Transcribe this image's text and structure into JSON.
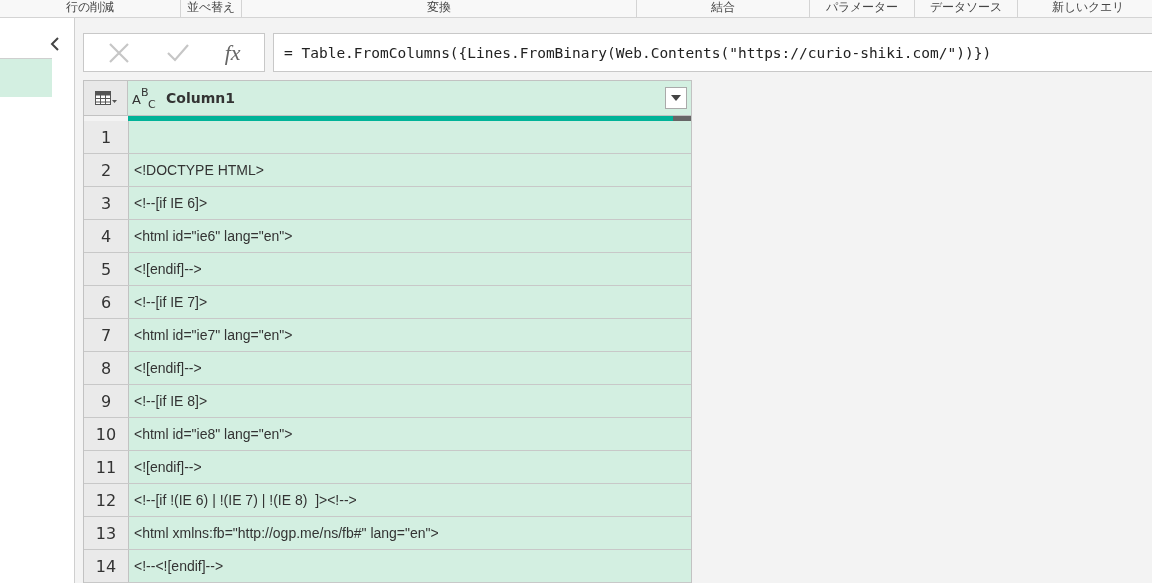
{
  "ribbon_groups": [
    "行の削減",
    "並べ替え",
    "変換",
    "結合",
    "パラメーター",
    "データソース",
    "新しいクエリ"
  ],
  "formula_bar": {
    "function_label": "fx",
    "value": "= Table.FromColumns({Lines.FromBinary(Web.Contents(\"https://curio-shiki.com/\"))})"
  },
  "queries_panel": {
    "collapsed": false,
    "items": [
      {
        "selected": true
      }
    ]
  },
  "table": {
    "columns": [
      {
        "type_letters": [
          "A",
          "B",
          "C"
        ],
        "label": "Column1"
      }
    ],
    "rows": [
      {
        "number": "1",
        "value": ""
      },
      {
        "number": "2",
        "value": "<!DOCTYPE HTML>"
      },
      {
        "number": "3",
        "value": "<!--[if IE 6]>"
      },
      {
        "number": "4",
        "value": "<html id=\"ie6\" lang=\"en\">"
      },
      {
        "number": "5",
        "value": "<![endif]-->"
      },
      {
        "number": "6",
        "value": "<!--[if IE 7]>"
      },
      {
        "number": "7",
        "value": "<html id=\"ie7\" lang=\"en\">"
      },
      {
        "number": "8",
        "value": "<![endif]-->"
      },
      {
        "number": "9",
        "value": "<!--[if IE 8]>"
      },
      {
        "number": "10",
        "value": "<html id=\"ie8\" lang=\"en\">"
      },
      {
        "number": "11",
        "value": "<![endif]-->"
      },
      {
        "number": "12",
        "value": "<!--[if !(IE 6) | !(IE 7) | !(IE 8)  ]><!-->"
      },
      {
        "number": "13",
        "value": "<html xmlns:fb=\"http://ogp.me/ns/fb#\" lang=\"en\">"
      },
      {
        "number": "14",
        "value": "<!--<![endif]-->"
      }
    ]
  }
}
